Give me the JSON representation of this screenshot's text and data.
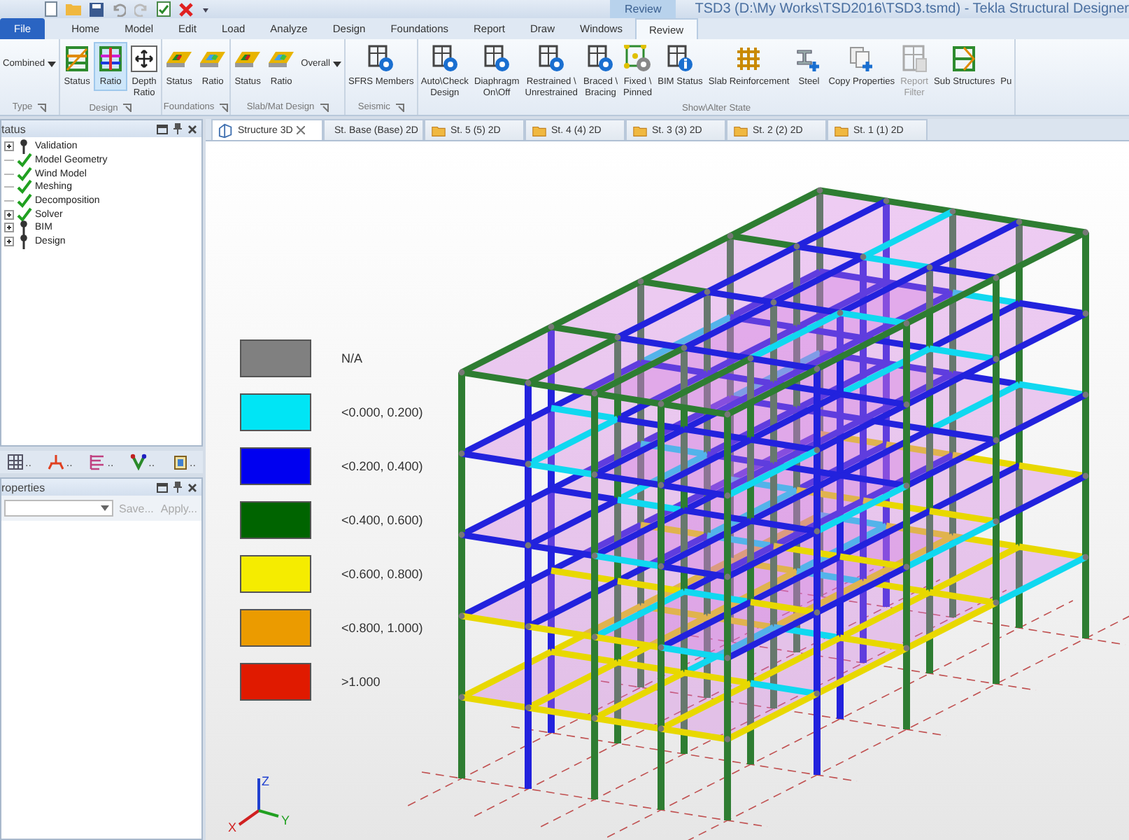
{
  "title_bar": {
    "context_tab": "Review",
    "title": "TSD3 (D:\\My Works\\TSD2016\\TSD3.tsmd) - Tekla Structural Designer"
  },
  "ribbon_tabs": [
    {
      "label": "File",
      "kind": "file",
      "selected": false
    },
    {
      "label": "Home",
      "kind": "tab",
      "selected": false
    },
    {
      "label": "Model",
      "kind": "tab",
      "selected": false
    },
    {
      "label": "Edit",
      "kind": "tab",
      "selected": false
    },
    {
      "label": "Load",
      "kind": "tab",
      "selected": false
    },
    {
      "label": "Analyze",
      "kind": "tab",
      "selected": false
    },
    {
      "label": "Design",
      "kind": "tab",
      "selected": false
    },
    {
      "label": "Foundations",
      "kind": "tab",
      "selected": false
    },
    {
      "label": "Report",
      "kind": "tab",
      "selected": false
    },
    {
      "label": "Draw",
      "kind": "tab",
      "selected": false
    },
    {
      "label": "Windows",
      "kind": "tab",
      "selected": false
    },
    {
      "label": "Review",
      "kind": "tab",
      "selected": true
    }
  ],
  "ribbon_groups": [
    {
      "label": "Type",
      "launcher": true,
      "buttons": [
        {
          "kind": "dropdown",
          "lines": [
            "Combined"
          ],
          "selected": false,
          "disabled": false
        }
      ]
    },
    {
      "label": "Design",
      "launcher": true,
      "buttons": [
        {
          "kind": "large",
          "lines": [
            "Status"
          ],
          "selected": false,
          "disabled": false
        },
        {
          "kind": "large",
          "lines": [
            "Ratio"
          ],
          "selected": true,
          "disabled": false
        },
        {
          "kind": "large",
          "lines": [
            "Depth",
            "Ratio"
          ],
          "selected": false,
          "disabled": false
        }
      ]
    },
    {
      "label": "Foundations",
      "launcher": true,
      "buttons": [
        {
          "kind": "large",
          "lines": [
            "Status"
          ],
          "selected": false,
          "disabled": false
        },
        {
          "kind": "large",
          "lines": [
            "Ratio"
          ],
          "selected": false,
          "disabled": false
        }
      ]
    },
    {
      "label": "Slab/Mat Design",
      "launcher": true,
      "buttons": [
        {
          "kind": "large",
          "lines": [
            "Status"
          ],
          "selected": false,
          "disabled": false
        },
        {
          "kind": "large",
          "lines": [
            "Ratio"
          ],
          "selected": false,
          "disabled": false
        },
        {
          "kind": "dropdown",
          "lines": [
            "Overall"
          ],
          "selected": false,
          "disabled": false
        }
      ]
    },
    {
      "label": "Seismic",
      "launcher": true,
      "buttons": [
        {
          "kind": "large",
          "lines": [
            "SFRS Members"
          ],
          "selected": false,
          "disabled": false
        }
      ]
    },
    {
      "label": "Show\\Alter State",
      "launcher": false,
      "buttons": [
        {
          "kind": "large",
          "lines": [
            "Auto\\Check",
            "Design"
          ],
          "selected": false,
          "disabled": false
        },
        {
          "kind": "large",
          "lines": [
            "Diaphragm",
            "On\\Off"
          ],
          "selected": false,
          "disabled": false
        },
        {
          "kind": "large",
          "lines": [
            "Restrained \\",
            "Unrestrained"
          ],
          "selected": false,
          "disabled": false
        },
        {
          "kind": "large",
          "lines": [
            "Braced \\",
            "Bracing"
          ],
          "selected": false,
          "disabled": false
        },
        {
          "kind": "large",
          "lines": [
            "Fixed \\",
            "Pinned"
          ],
          "selected": false,
          "disabled": false
        },
        {
          "kind": "large",
          "lines": [
            "BIM Status"
          ],
          "selected": false,
          "disabled": false
        },
        {
          "kind": "large",
          "lines": [
            "Slab Reinforcement"
          ],
          "selected": false,
          "disabled": false
        },
        {
          "kind": "large",
          "lines": [
            "Steel"
          ],
          "selected": false,
          "disabled": false
        },
        {
          "kind": "large",
          "lines": [
            "Copy Properties"
          ],
          "selected": false,
          "disabled": false
        },
        {
          "kind": "large",
          "lines": [
            "Report",
            "Filter"
          ],
          "selected": false,
          "disabled": true
        },
        {
          "kind": "large",
          "lines": [
            "Sub Structures"
          ],
          "selected": false,
          "disabled": false
        },
        {
          "kind": "large",
          "lines": [
            "Pu"
          ],
          "selected": false,
          "disabled": false
        }
      ]
    }
  ],
  "status_panel": {
    "title": "tatus",
    "items": [
      {
        "label": "Validation",
        "kind": "pending",
        "expanded": false
      },
      {
        "label": "Model Geometry",
        "kind": "done"
      },
      {
        "label": "Wind Model",
        "kind": "done"
      },
      {
        "label": "Meshing",
        "kind": "done"
      },
      {
        "label": "Decomposition",
        "kind": "done"
      },
      {
        "label": "Solver",
        "kind": "done",
        "expanded": false
      },
      {
        "label": "BIM",
        "kind": "pending",
        "expanded": false
      },
      {
        "label": "Design",
        "kind": "pending",
        "expanded": false
      }
    ]
  },
  "panel_tabs": [
    {
      "label": ".."
    },
    {
      "label": ".."
    },
    {
      "label": ".."
    },
    {
      "label": ".."
    },
    {
      "label": ".."
    }
  ],
  "properties_panel": {
    "title": "roperties",
    "buttons": [
      {
        "label": "Save...",
        "disabled": true
      },
      {
        "label": "Apply...",
        "disabled": true
      }
    ]
  },
  "doc_tabs": [
    {
      "label": "Structure 3D",
      "kind": "view3d",
      "selected": true
    },
    {
      "label": "St. Base (Base) 2D",
      "kind": "plan",
      "selected": false
    },
    {
      "label": "St. 5 (5) 2D",
      "kind": "plan",
      "selected": false
    },
    {
      "label": "St. 4 (4) 2D",
      "kind": "plan",
      "selected": false
    },
    {
      "label": "St. 3 (3) 2D",
      "kind": "plan",
      "selected": false
    },
    {
      "label": "St. 2 (2) 2D",
      "kind": "plan",
      "selected": false
    },
    {
      "label": "St. 1 (1) 2D",
      "kind": "plan",
      "selected": false
    }
  ],
  "legend": [
    {
      "color": "#808080",
      "label": "N/A"
    },
    {
      "color": "#00e5f5",
      "label": "<0.000, 0.200)"
    },
    {
      "color": "#0000f0",
      "label": "<0.200, 0.400)"
    },
    {
      "color": "#006400",
      "label": "<0.400, 0.600)"
    },
    {
      "color": "#f5ec00",
      "label": "<0.600, 0.800)"
    },
    {
      "color": "#eb9b00",
      "label": "<0.800, 1.000)"
    },
    {
      "color": "#e01a00",
      "label": ">1.000"
    }
  ],
  "axes": {
    "x": "X",
    "y": "Y",
    "z": "Z"
  }
}
